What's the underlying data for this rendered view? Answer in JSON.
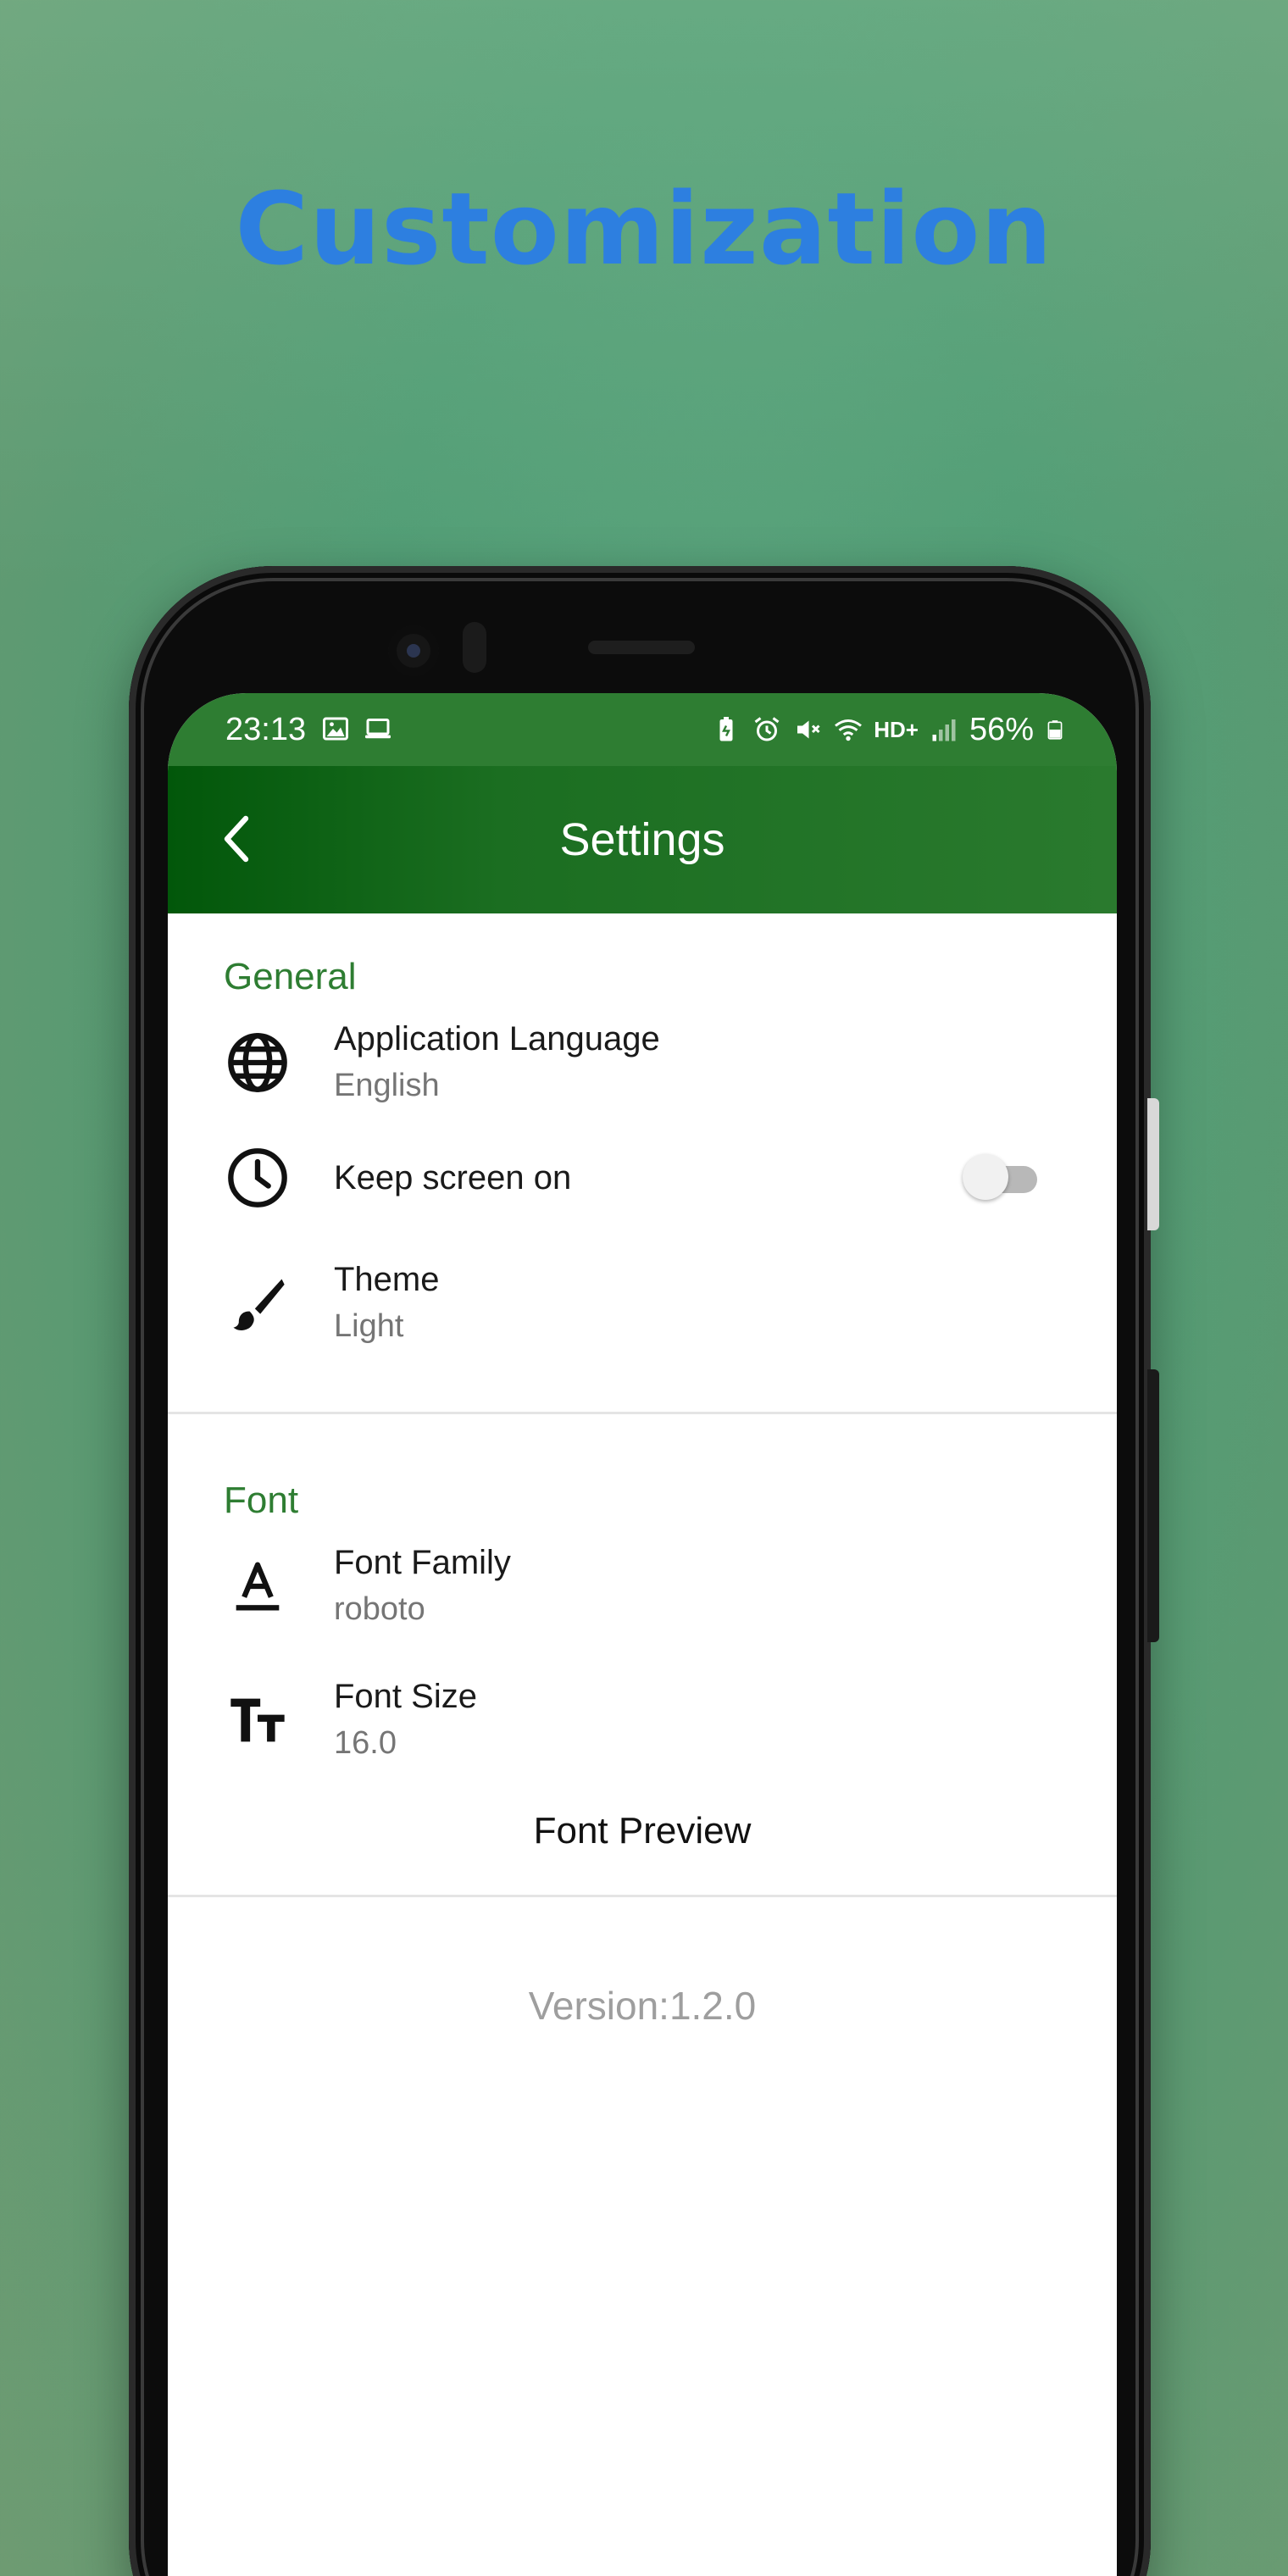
{
  "promo": {
    "headline": "Customization",
    "headline_color": "#2d7fe0"
  },
  "status_bar": {
    "time": "23:13",
    "battery": "56%",
    "network": "HD+",
    "left_icons": [
      "image-icon",
      "laptop-icon"
    ],
    "right_icons": [
      "battery-saver-icon",
      "alarm-icon",
      "mute-icon",
      "wifi-icon",
      "signal-icon",
      "battery-icon"
    ]
  },
  "app_bar": {
    "title": "Settings",
    "back_icon": "chevron-left-icon",
    "color": "#2e7d32"
  },
  "sections": {
    "general": {
      "header": "General",
      "items": {
        "language": {
          "title": "Application Language",
          "value": "English",
          "icon": "globe-icon"
        },
        "keep_screen": {
          "title": "Keep screen on",
          "toggle_on": false,
          "icon": "clock-icon"
        },
        "theme": {
          "title": "Theme",
          "value": "Light",
          "icon": "brush-icon"
        }
      }
    },
    "font": {
      "header": "Font",
      "items": {
        "family": {
          "title": "Font Family",
          "value": "roboto",
          "icon": "font-family-icon"
        },
        "size": {
          "title": "Font Size",
          "value": "16.0",
          "icon": "text-size-icon"
        }
      },
      "preview": "Font Preview"
    }
  },
  "footer": {
    "version": "Version:1.2.0"
  },
  "colors": {
    "accent_green": "#2e7d32",
    "secondary_text": "#757575"
  }
}
